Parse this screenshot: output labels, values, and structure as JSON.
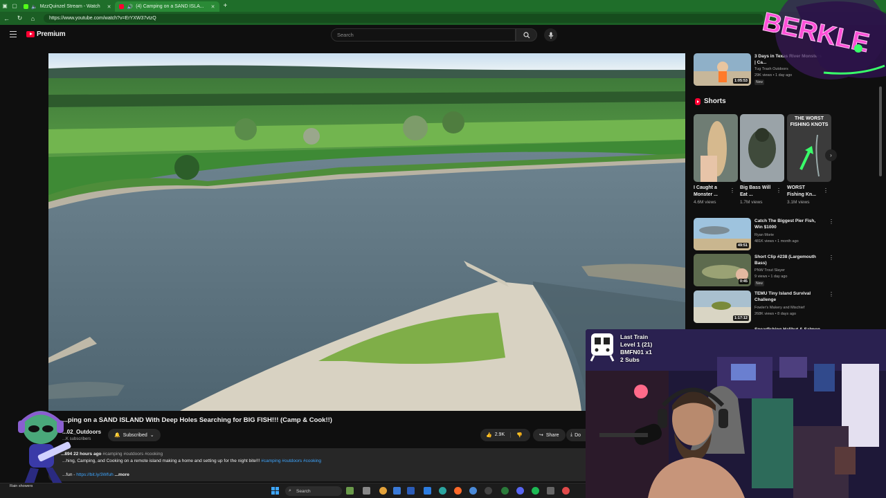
{
  "browser": {
    "tabs": [
      {
        "label": "MzzQuinzel Stream - Watch",
        "active": false
      },
      {
        "label": "(4) Camping on a SAND ISLA...",
        "active": true
      }
    ],
    "new_tab": "+",
    "url": "https://www.youtube.com/watch?v=ErYXW37vtzQ"
  },
  "youtube": {
    "logo": "Premium",
    "search_placeholder": "Search"
  },
  "video": {
    "title": "...ping on a SAND ISLAND With Deep Holes Searching for BIG FISH!!! (Camp & Cook!!)",
    "channel": "...02_Outdoors",
    "subscribers": "...K subscribers",
    "subscribe_label": "Subscribed",
    "likes": "2.9K",
    "share_label": "Share",
    "download_label": "Do",
    "description": {
      "views": "...894",
      "time": "22 hours ago",
      "tags_top": "#camping #outdoors #cooking",
      "text": "...hing, Camping, and Cooking on a remote island making a home and setting up for the night bite!!!",
      "tags_inline": "#camping #outdoors #cooking",
      "link_prefix": "...fun -",
      "link_url": "https://bit.ly/3Wfuh",
      "more": "...more"
    }
  },
  "sidebar": {
    "top_rec": {
      "title": "3 Days in Texas River Monsters | Ca...",
      "channel": "Tug Trash Outdoors",
      "views": "29K views • 1 day ago",
      "badge": "New",
      "duration": "1:05:53"
    },
    "shorts_heading": "Shorts",
    "shorts": [
      {
        "title": "I Caught a Monster ...",
        "views": "4.6M views"
      },
      {
        "title": "Big Bass Will Eat ...",
        "views": "1.7M views"
      },
      {
        "title": "WORST Fishing Kn...",
        "views": "3.1M views",
        "overlay": "THE WORST FISHING KNOTS"
      }
    ],
    "recs": [
      {
        "title": "Catch The Biggest Pier Fish, Win $1000",
        "channel": "Ryan Morie",
        "views": "481K views • 1 month ago",
        "duration": "49:51",
        "badge": ""
      },
      {
        "title": "Short Clip #238 (Largemouth Bass)",
        "channel": "PNW Trout Slayer",
        "views": "9 views • 1 day ago",
        "duration": "0:45",
        "badge": "New"
      },
      {
        "title": "TEMU Tiny Island Survival Challenge",
        "channel": "Fowler's Makery and Mischief",
        "views": "268K views • 8 days ago",
        "duration": "1:17:12",
        "badge": ""
      },
      {
        "title": "Spearfishing Halibut & Salmon",
        "channel": "",
        "views": "",
        "duration": "",
        "badge": ""
      }
    ]
  },
  "stream": {
    "alert_lines": [
      "Last Train",
      "Level 1  (21)",
      "BMFN01 x1",
      "2 Subs"
    ],
    "logo_text": "BERKLE"
  },
  "taskbar": {
    "search": "Search",
    "weather": "Rain showers"
  },
  "colors": {
    "browser_green": "#1f6e2a",
    "yt_red": "#ff0033",
    "link_blue": "#3ea6ff",
    "neon_pink": "#ff4fd8",
    "neon_green": "#39ff6a"
  }
}
